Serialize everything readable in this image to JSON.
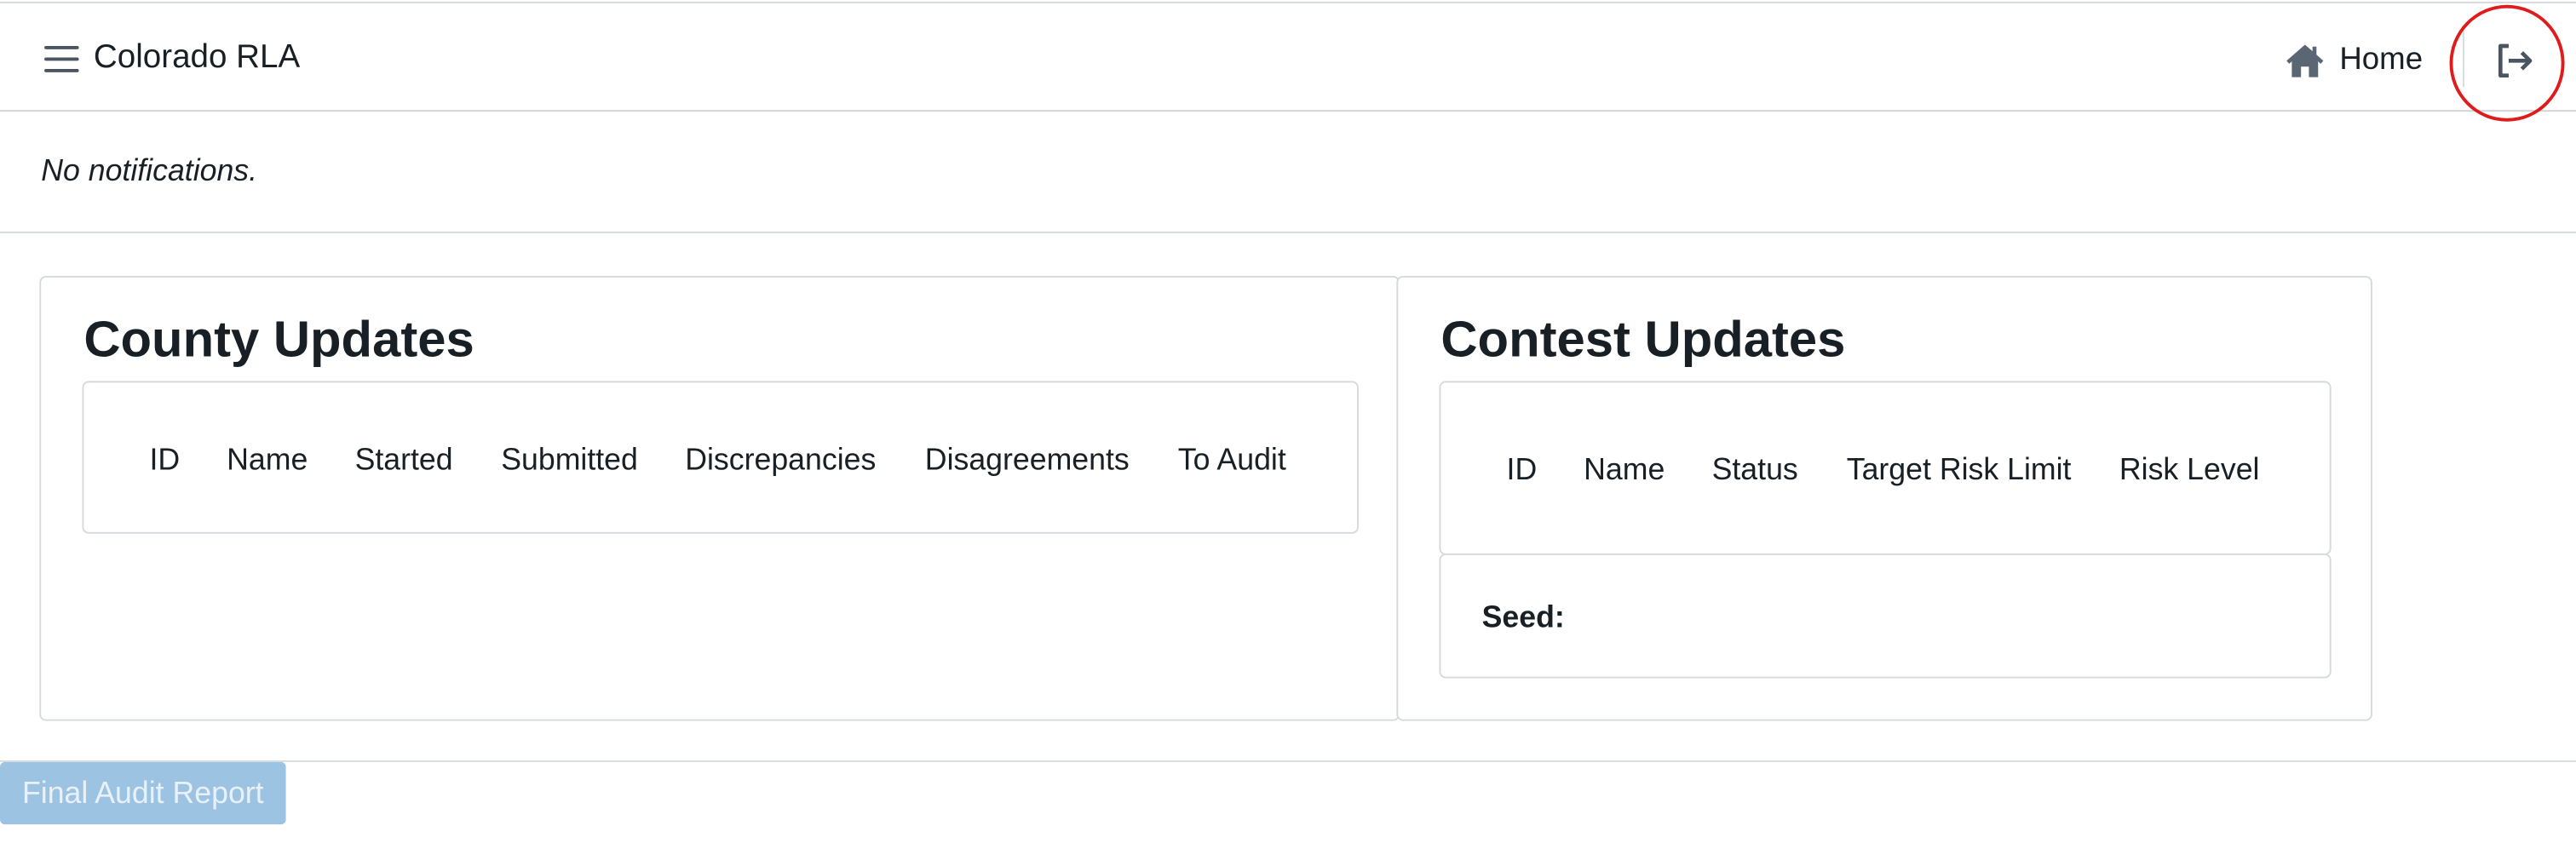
{
  "navbar": {
    "app_title": "Colorado RLA",
    "menu_icon": "hamburger-menu-icon",
    "home_label": "Home",
    "home_icon": "home-icon",
    "logout_icon": "log-out-icon",
    "highlight_color": "#e01b1b"
  },
  "notifications": {
    "text": "No notifications."
  },
  "county_updates": {
    "title": "County Updates",
    "columns": [
      "ID",
      "Name",
      "Started",
      "Submitted",
      "Discrepancies",
      "Disagreements",
      "To Audit"
    ],
    "rows": []
  },
  "contest_updates": {
    "title": "Contest Updates",
    "columns": [
      "ID",
      "Name",
      "Status",
      "Target Risk Limit",
      "Risk Level"
    ],
    "rows": [],
    "seed_label": "Seed:",
    "seed_value": ""
  },
  "actions": {
    "final_audit_report_label": "Final Audit Report",
    "final_audit_report_disabled": true,
    "button_color": "#9dc3e3"
  }
}
